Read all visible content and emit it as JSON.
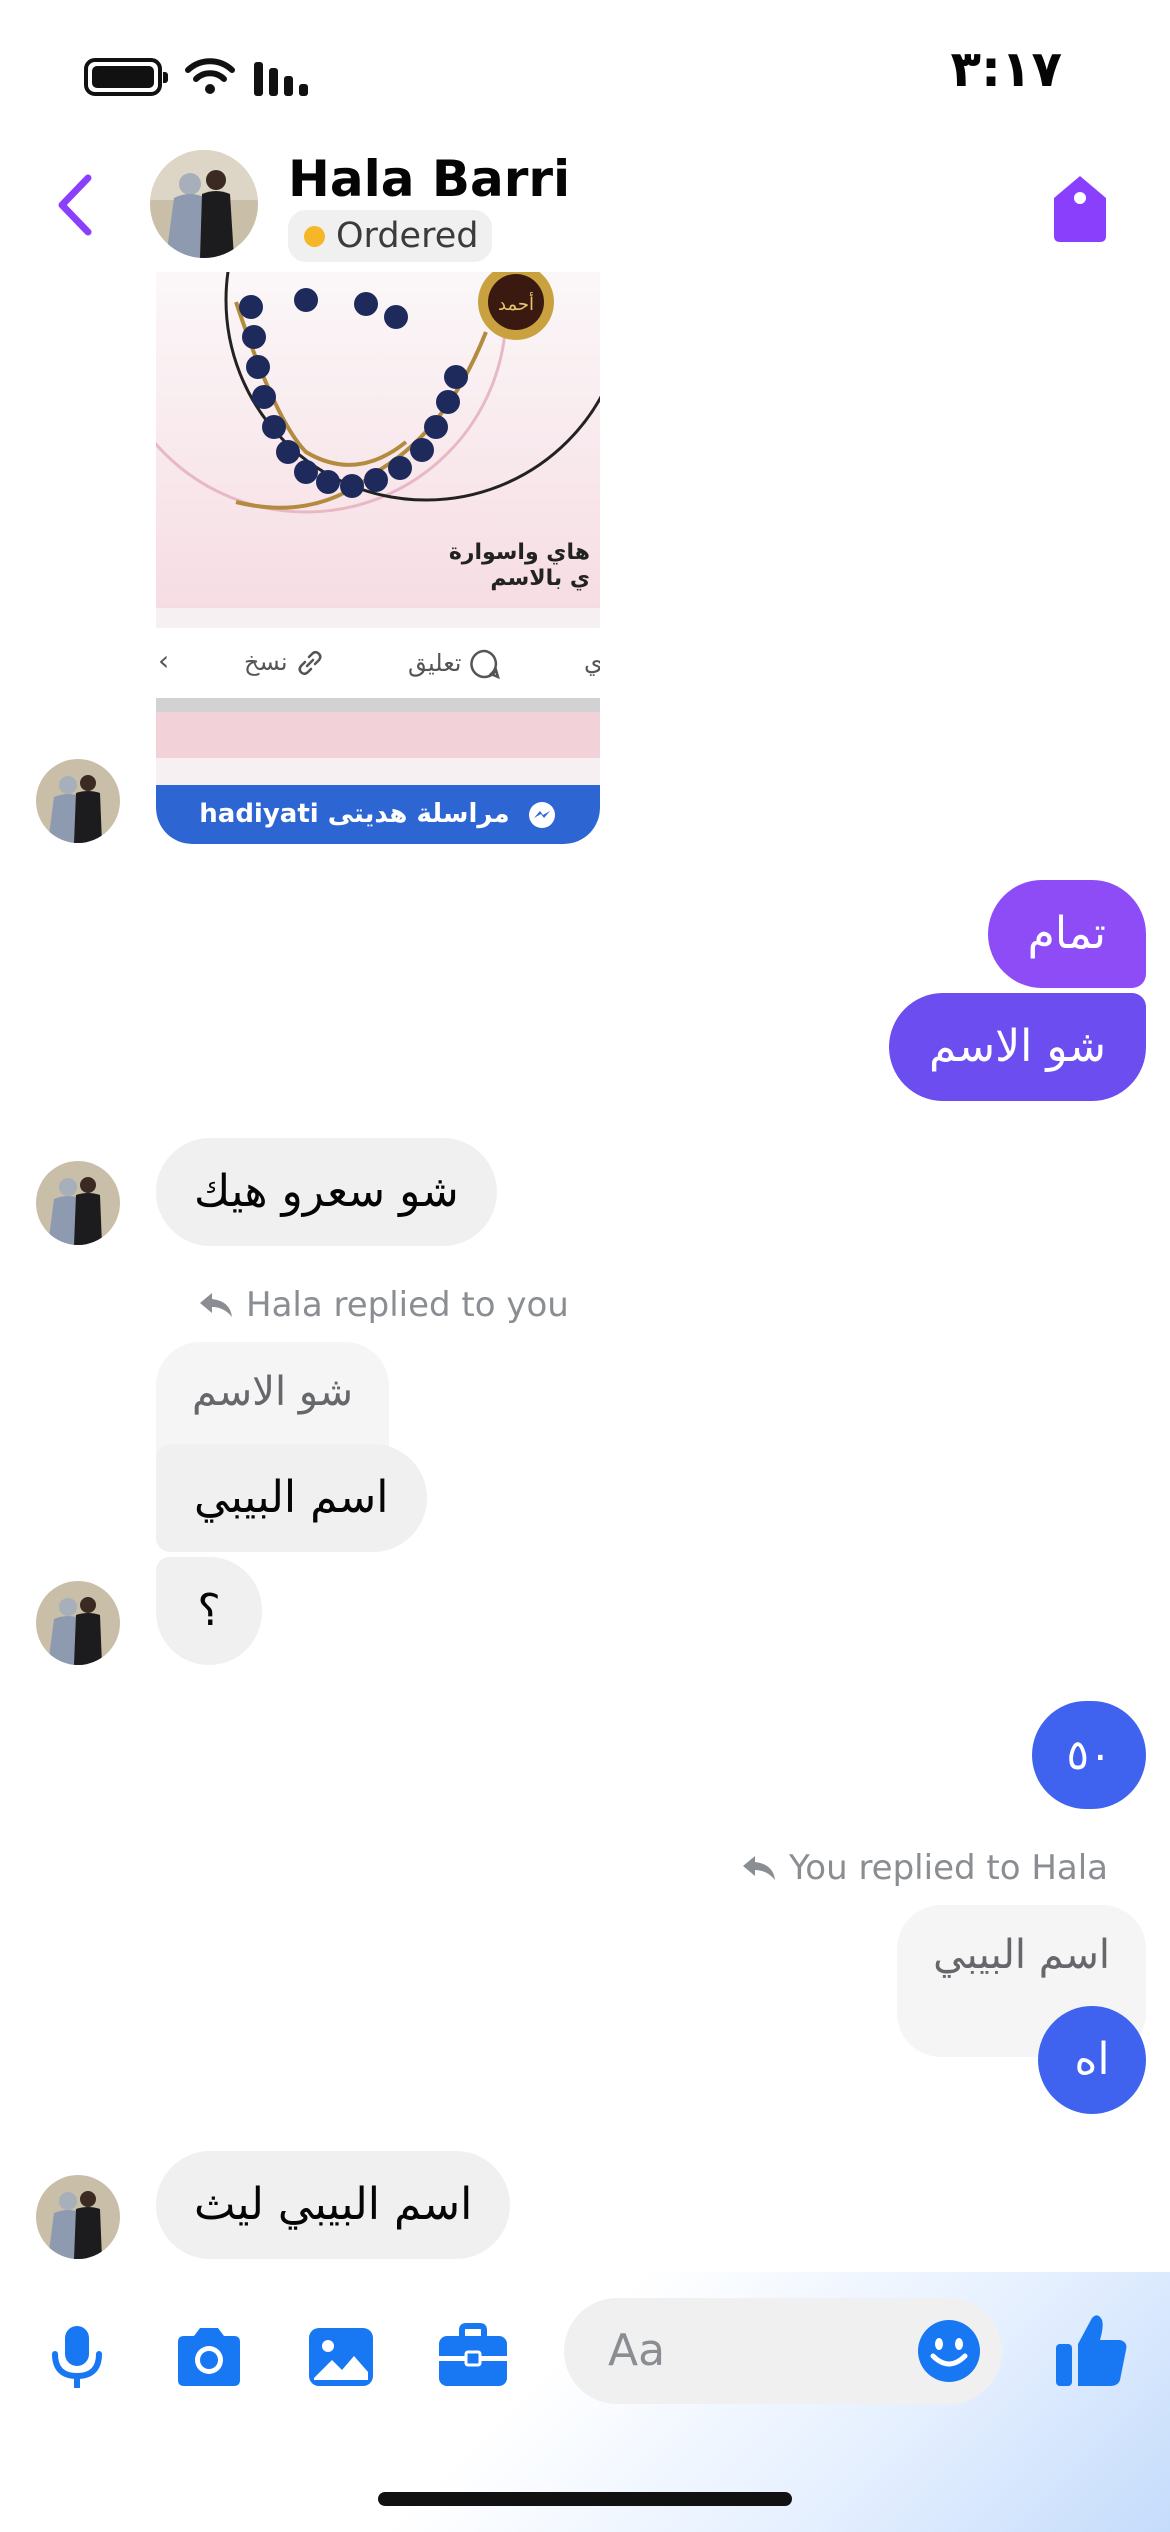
{
  "status_bar": {
    "time": "٣:١٧"
  },
  "header": {
    "contact_name": "Hala Barri",
    "order_status": "Ordered",
    "accent_color": "#8a3ffc",
    "status_dot_color": "#f5b728"
  },
  "attachment": {
    "caption_line1": "هاي واسوارة",
    "caption_line2": "ي بالاسم",
    "pendant_text": "أحمد",
    "action_copy": "نسخ",
    "action_comment": "تعليق",
    "action_partial": "ي",
    "cta_label": "hadiyati مراسلة هديتى"
  },
  "messages": {
    "out_1": "تمام",
    "out_2": "شو الاسم",
    "in_1": "شو سعرو هيك",
    "reply_label_1": "Hala replied to you",
    "quoted_1": "شو الاسم",
    "in_2": "اسم البيبي",
    "in_3": "؟",
    "out_3": "٥٠",
    "reply_label_2": "You replied to Hala",
    "quoted_2": "اسم البيبي",
    "out_4": "اه",
    "in_4": "اسم البيبي ليث"
  },
  "composer": {
    "placeholder": "Aa",
    "icon_color": "#1877f2"
  },
  "colors": {
    "bubble_purple": "#8e4cf7",
    "bubble_indigo": "#6b4df0",
    "bubble_blue": "#3f63ef",
    "incoming_bubble": "#f0f0f0"
  }
}
